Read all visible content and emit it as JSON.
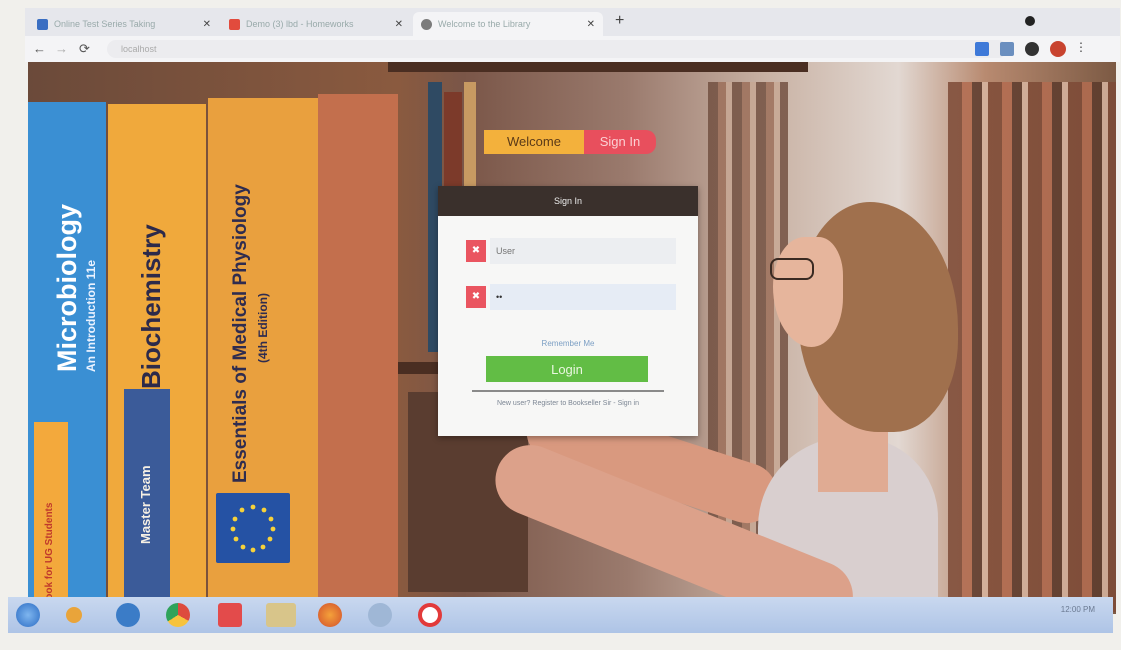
{
  "browser": {
    "tabs": [
      {
        "title": "Online Test Series Taking",
        "favicon_color": "#3a6ec2"
      },
      {
        "title": "Demo (3) lbd - Homeworks",
        "favicon_color": "#e24b3d"
      },
      {
        "title": "Welcome to the Library",
        "favicon_color": "#7b7b7b"
      }
    ],
    "new_tab_label": "+",
    "address": "localhost"
  },
  "page": {
    "books": [
      {
        "title": "Microbiology",
        "subtitle": "An Introduction  11e",
        "color": "#3a8fd3"
      },
      {
        "title": "Biochemistry",
        "subtitle": "",
        "color": "#f0a93c"
      },
      {
        "title": "Essentials of Medical Physiology",
        "subtitle": "(4th Edition)",
        "color": "#e9a03e"
      }
    ],
    "book_badges": {
      "microbiology_strip": "Book for UG Students",
      "biochemistry_strip": "Master Team"
    },
    "welcome_label": "Welcome",
    "signin_label": "Sign In",
    "login_card": {
      "header": "Sign In",
      "username_placeholder": "User",
      "password_value": "••",
      "remember_text": "Remember Me",
      "login_button": "Login",
      "footer_text": "New user? Register to Bookseller Sir - Sign in"
    }
  },
  "taskbar": {
    "tray_time": "12:00 PM"
  },
  "colors": {
    "accent_red": "#e84f5d",
    "accent_orange": "#f3b13c",
    "login_green": "#62bd45"
  }
}
